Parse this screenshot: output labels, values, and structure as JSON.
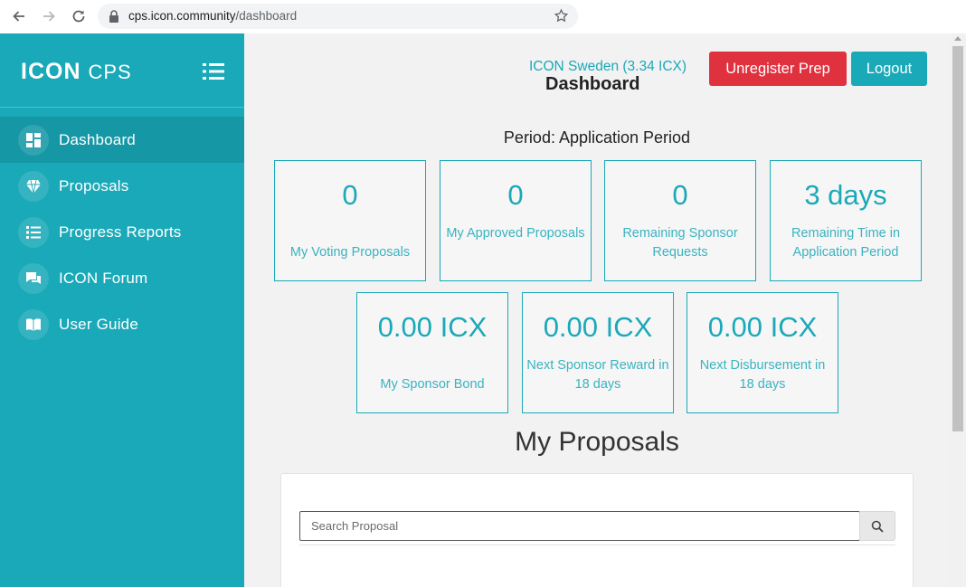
{
  "browser": {
    "url_domain": "cps.icon.community",
    "url_path": "/dashboard"
  },
  "sidebar": {
    "brand": "ICON",
    "product": "CPS",
    "items": [
      {
        "label": "Dashboard",
        "icon": "dashboard-icon",
        "active": true
      },
      {
        "label": "Proposals",
        "icon": "diamond-icon",
        "active": false
      },
      {
        "label": "Progress Reports",
        "icon": "list-icon",
        "active": false
      },
      {
        "label": "ICON Forum",
        "icon": "chat-icon",
        "active": false
      },
      {
        "label": "User Guide",
        "icon": "book-icon",
        "active": false
      }
    ]
  },
  "header": {
    "user": "ICON Sweden (3.34 ICX)",
    "title": "Dashboard",
    "unregister_label": "Unregister Prep",
    "logout_label": "Logout"
  },
  "period": "Period: Application Period",
  "cards_row1": [
    {
      "value": "0",
      "label": "My Voting Proposals"
    },
    {
      "value": "0",
      "label": "My Approved Proposals"
    },
    {
      "value": "0",
      "label": "Remaining Sponsor Requests"
    },
    {
      "value": "3 days",
      "label": "Remaining Time in Application Period"
    }
  ],
  "cards_row2": [
    {
      "value": "0.00 ICX",
      "label": "My Sponsor Bond"
    },
    {
      "value": "0.00 ICX",
      "label": "Next Sponsor Reward in 18 days"
    },
    {
      "value": "0.00 ICX",
      "label": "Next Disbursement in 18 days"
    }
  ],
  "proposals": {
    "title": "My Proposals",
    "search_placeholder": "Search Proposal"
  },
  "colors": {
    "accent": "#1aa9b8",
    "danger": "#e0313f"
  }
}
